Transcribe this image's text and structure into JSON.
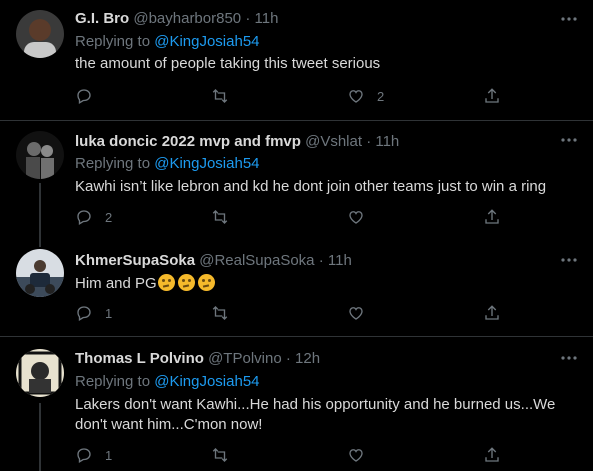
{
  "tweets": [
    {
      "name": "G.I. Bro",
      "handle": "@bayharbor850",
      "time": "11h",
      "replying_label": "Replying to",
      "replying_to": "@KingJosiah54",
      "text": "the amount of people taking this tweet serious",
      "reply_count": "",
      "retweet_count": "",
      "like_count": "2"
    },
    {
      "name": "luka doncic 2022 mvp and fmvp",
      "handle": "@Vshlat",
      "time": "11h",
      "replying_label": "Replying to",
      "replying_to": "@KingJosiah54",
      "text": "Kawhi isn’t like lebron and kd he dont join other teams just to win a ring",
      "reply_count": "2",
      "retweet_count": "",
      "like_count": ""
    },
    {
      "name": "KhmerSupaSoka",
      "handle": "@RealSupaSoka",
      "time": "11h",
      "text": "Him and PG",
      "emojis": [
        "thinking-face",
        "thinking-face",
        "thinking-face"
      ],
      "reply_count": "1",
      "retweet_count": "",
      "like_count": ""
    },
    {
      "name": "Thomas L Polvino",
      "handle": "@TPolvino",
      "time": "12h",
      "replying_label": "Replying to",
      "replying_to": "@KingJosiah54",
      "text": "Lakers don't want Kawhi...He had his opportunity and he burned us...We don't want him...C'mon now!",
      "reply_count": "1",
      "retweet_count": "",
      "like_count": ""
    }
  ],
  "separator": "·",
  "colors": {
    "background": "#000000",
    "text": "#d9d9d9",
    "muted": "#6e767d",
    "link": "#1d9bf0",
    "divider": "#2f3336"
  },
  "icons": [
    "reply-icon",
    "retweet-icon",
    "like-icon",
    "share-icon",
    "more-icon"
  ]
}
